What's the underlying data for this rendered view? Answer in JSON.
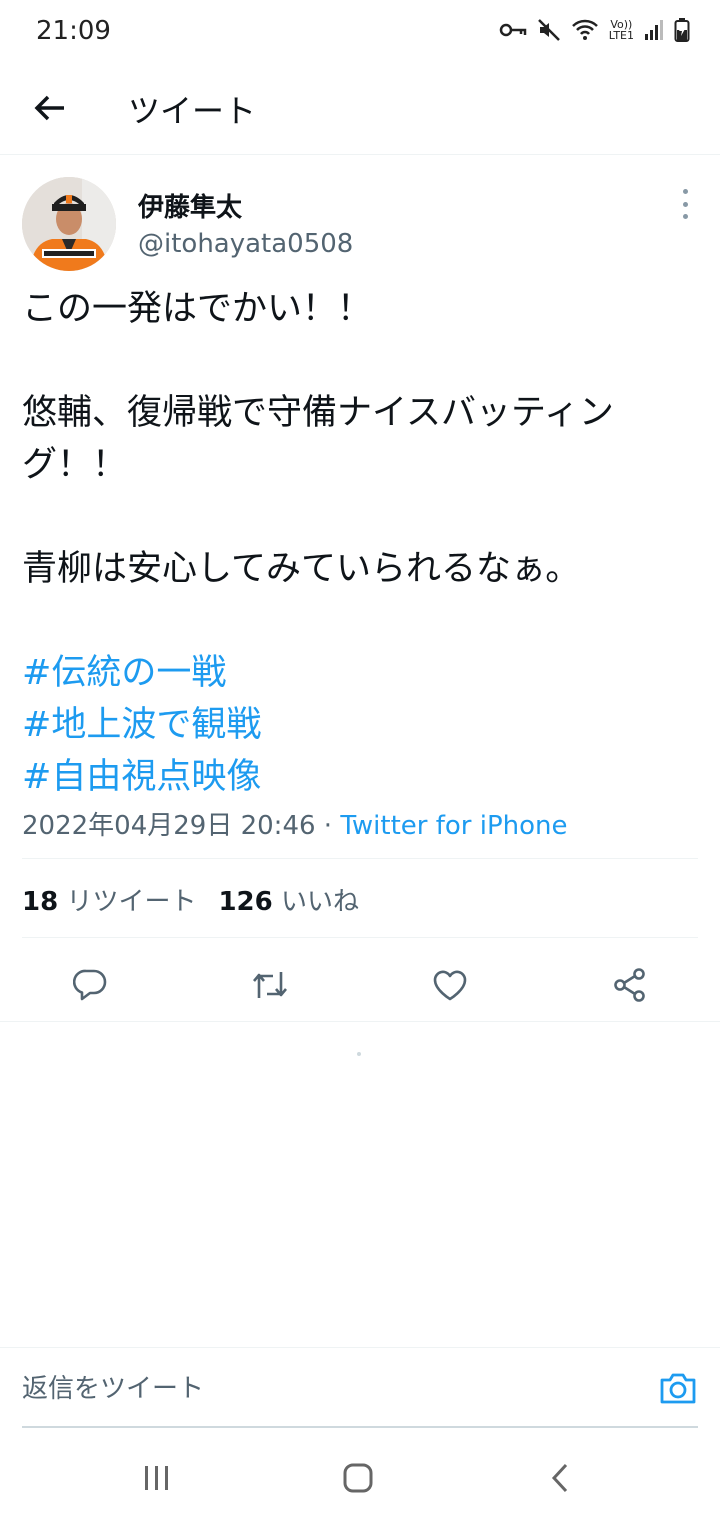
{
  "status_bar": {
    "time": "21:09",
    "volte_top": "Vo))",
    "volte_bottom": "LTE1",
    "icons": [
      "vpn-key-icon",
      "mute-icon",
      "wifi-icon",
      "volte-icon",
      "signal-icon",
      "battery-icon"
    ]
  },
  "header": {
    "title": "ツイート",
    "back_icon": "arrow-left-icon"
  },
  "tweet": {
    "display_name": "伊藤隼太",
    "handle": "@itohayata0508",
    "body_lines": [
      "この一発はでかい！！",
      "",
      "悠輔、復帰戦で守備ナイスバッティン",
      "グ！！",
      "",
      "青柳は安心してみていられるなぁ。",
      ""
    ],
    "hashtags": [
      "#伝統の一戦",
      "#地上波で観戦",
      "#自由視点映像"
    ],
    "timestamp": "2022年04月29日 20:46",
    "separator": " · ",
    "source": "Twitter for iPhone",
    "retweet_count": "18",
    "retweet_label": "リツイート",
    "like_count": "126",
    "like_label": "いいね"
  },
  "actions": [
    {
      "name": "reply",
      "icon": "reply-icon"
    },
    {
      "name": "retweet",
      "icon": "retweet-icon"
    },
    {
      "name": "like",
      "icon": "heart-icon"
    },
    {
      "name": "share",
      "icon": "share-icon"
    }
  ],
  "reply_bar": {
    "placeholder": "返信をツイート",
    "camera_icon": "camera-icon"
  },
  "nav_bar": {
    "icons": [
      "recent-apps-icon",
      "home-icon",
      "back-icon"
    ]
  },
  "colors": {
    "accent": "#1d9bf0",
    "text": "#0f1419",
    "secondary": "#536471",
    "divider": "#eff3f4"
  }
}
